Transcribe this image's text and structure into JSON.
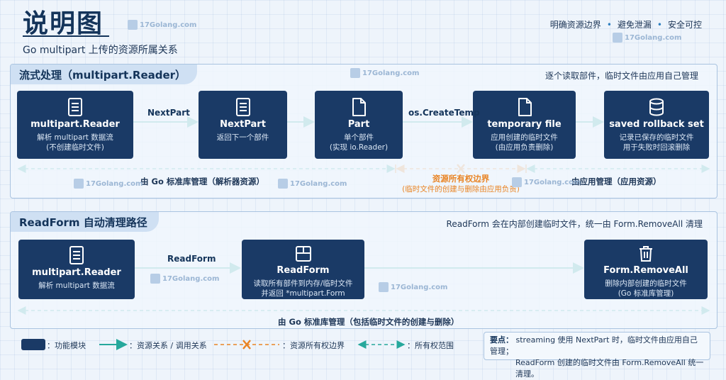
{
  "header": {
    "title": "说明图",
    "subtitle": "Go multipart 上传的资源所属关系",
    "tags": [
      "明确资源边界",
      "避免泄漏",
      "安全可控"
    ],
    "watermark": "17Golang.com"
  },
  "section1": {
    "title": "流式处理（multipart.Reader）",
    "note": "逐个读取部件，临时文件由应用自己管理",
    "nodes": [
      {
        "name": "multipart.Reader",
        "desc1": "解析 multipart 数据流",
        "desc2": "(不创建临时文件)",
        "icon": "document-icon"
      },
      {
        "name": "NextPart",
        "desc1": "返回下一个部件",
        "desc2": "",
        "icon": "document-icon"
      },
      {
        "name": "Part",
        "desc1": "单个部件",
        "desc2": "(实现 io.Reader)",
        "icon": "file-icon"
      },
      {
        "name": "temporary file",
        "desc1": "应用创建的临时文件",
        "desc2": "(由应用负责删除)",
        "icon": "file-icon"
      },
      {
        "name": "saved rollback set",
        "desc1": "记录已保存的临时文件",
        "desc2": "用于失败时回滚删除",
        "icon": "database-icon"
      }
    ],
    "edges": [
      "NextPart",
      "",
      "os.CreateTemp",
      ""
    ],
    "scope_left": "由 Go 标准库管理（解析器资源）",
    "boundary_line1": "资源所有权边界",
    "boundary_line2": "(临时文件的创建与删除由应用负责)",
    "scope_right": "由应用管理（应用资源）"
  },
  "section2": {
    "title": "ReadForm 自动清理路径",
    "note": "ReadForm 会在内部创建临时文件，统一由 Form.RemoveAll 清理",
    "nodes": [
      {
        "name": "multipart.Reader",
        "desc1": "解析 multipart 数据流",
        "desc2": "",
        "icon": "document-icon"
      },
      {
        "name": "ReadForm",
        "desc1": "读取所有部件到内存/临时文件",
        "desc2": "并返回 *multipart.Form",
        "icon": "form-icon"
      },
      {
        "name": "Form.RemoveAll",
        "desc1": "删除内部创建的临时文件",
        "desc2": "(Go 标准库管理)",
        "icon": "trash-icon"
      }
    ],
    "edges": [
      "ReadForm",
      ""
    ],
    "scope": "由 Go 标准库管理（包括临时文件的创建与删除）"
  },
  "legend": {
    "module": "：功能模块",
    "relation": "：资源关系 / 调用关系",
    "boundary": "：资源所有权边界",
    "scope": "：所有权范围"
  },
  "keypoints": {
    "label": "要点：",
    "line1": "streaming 使用 NextPart 时，临时文件由应用自己管理；",
    "line2": "ReadForm 创建的临时文件由 Form.RemoveAll 统一清理。"
  },
  "colors": {
    "node": "#1a3a66",
    "arrow": "#26a89c",
    "boundary": "#e98424",
    "text": "#14345a"
  }
}
